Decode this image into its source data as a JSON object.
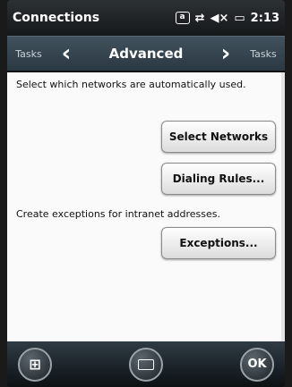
{
  "status_bar": {
    "title": "Connections",
    "time": "2:13",
    "notification_icon": "a",
    "network_icon": "sync-arrows",
    "volume_icon": "speaker-muted",
    "battery_icon": "battery"
  },
  "tab_bar": {
    "left_tab": "Tasks",
    "current_tab": "Advanced",
    "right_tab": "Tasks"
  },
  "content": {
    "line1": "Select which networks are automatically used.",
    "select_networks": "Select Networks",
    "dialing_rules": "Dialing Rules...",
    "line2": "Create exceptions for intranet addresses.",
    "exceptions": "Exceptions..."
  },
  "bottom_bar": {
    "ok": "OK"
  }
}
